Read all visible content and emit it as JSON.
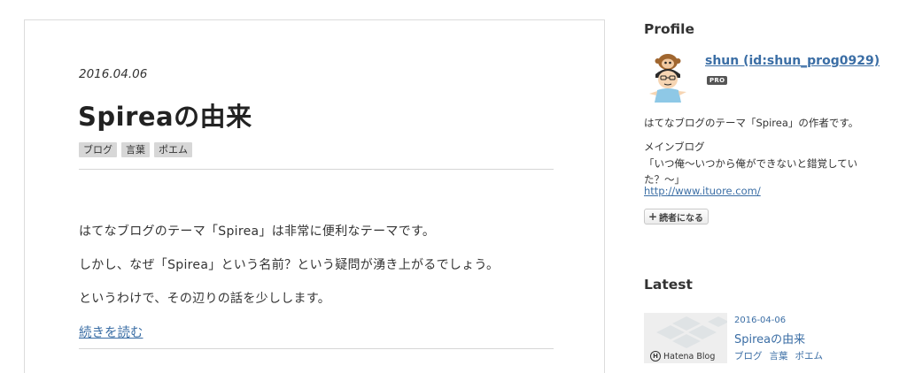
{
  "post": {
    "date": "2016.04.06",
    "title": "Spireaの由来",
    "tags": [
      "ブログ",
      "言葉",
      "ポエム"
    ],
    "paragraphs": [
      "はてなブログのテーマ「Spirea」は非常に便利なテーマです。",
      "しかし、なぜ「Spirea」という名前？という疑問が湧き上がるでしょう。",
      "というわけで、その辺りの話を少しします。"
    ],
    "read_more": "続きを読む"
  },
  "sidebar": {
    "profile": {
      "heading": "Profile",
      "username": "shun (id:shun_prog0929)",
      "badge": "PRO",
      "description": "はてなブログのテーマ「Spirea」の作者です。",
      "main_blog_label": "メインブログ",
      "main_blog_name": "「いつ俺〜いつから俺ができないと錯覚していた？〜」",
      "main_blog_url": "http://www.ituore.com/",
      "subscribe_label": "読者になる"
    },
    "latest": {
      "heading": "Latest",
      "thumb_brand": "Hatena Blog",
      "items": [
        {
          "date": "2016-04-06",
          "title": "Spireaの由来",
          "tags": [
            "ブログ",
            "言葉",
            "ポエム"
          ]
        }
      ]
    }
  },
  "colors": {
    "link": "#3b6ea5",
    "tag_bg": "#d7d7d7",
    "border": "#dcdcdc"
  }
}
